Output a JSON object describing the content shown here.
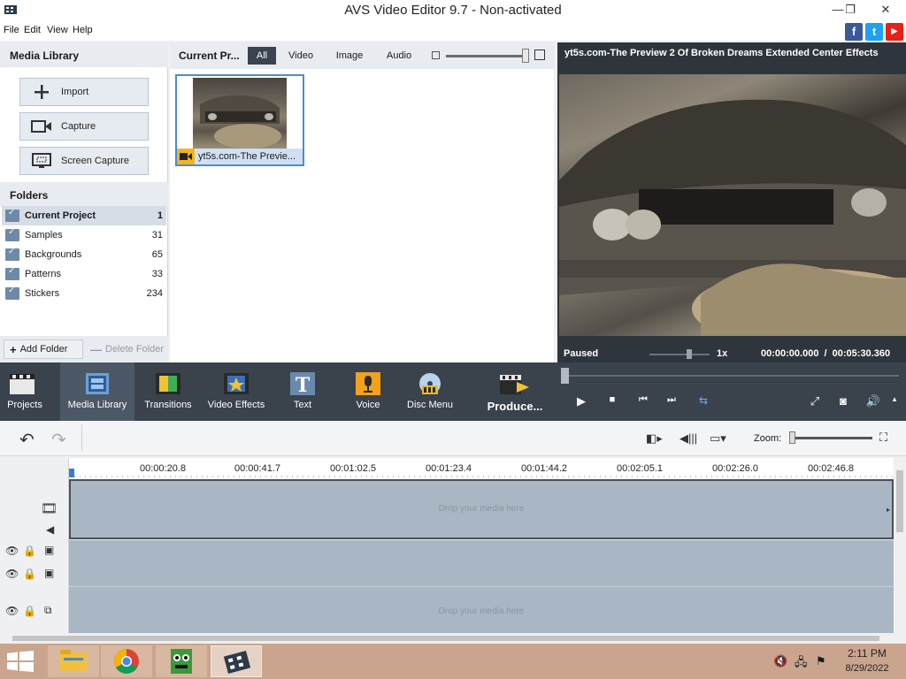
{
  "window": {
    "title": "AVS Video Editor 9.7 - Non-activated",
    "minimize_icon": "—",
    "restore_icon": "❐",
    "close_icon": "✕"
  },
  "menu": [
    "File",
    "Edit",
    "View",
    "Help"
  ],
  "social": {
    "facebook": "f",
    "twitter": "t",
    "youtube": "▶"
  },
  "media_library": {
    "title": "Media Library",
    "buttons": [
      "Import",
      "Capture",
      "Screen Capture"
    ]
  },
  "folders": {
    "title": "Folders",
    "items": [
      {
        "name": "Current Project",
        "count": "1"
      },
      {
        "name": "Samples",
        "count": "31"
      },
      {
        "name": "Backgrounds",
        "count": "65"
      },
      {
        "name": "Patterns",
        "count": "33"
      },
      {
        "name": "Stickers",
        "count": "234"
      }
    ],
    "add_label": "Add Folder",
    "delete_label": "Delete Folder"
  },
  "center": {
    "title": "Current Pr...",
    "tabs": [
      "All",
      "Video",
      "Image",
      "Audio"
    ],
    "active_tab": "All",
    "items": [
      {
        "caption": "yt5s.com-The Previe..."
      }
    ]
  },
  "preview": {
    "title": "yt5s.com-The Preview 2 Of Broken Dreams Extended Center Effects",
    "status": "Paused",
    "speed": "1x",
    "current_time": "00:00:00.000",
    "separator": "/",
    "total_time": "00:05:30.360"
  },
  "toolbar": {
    "items": [
      {
        "label": "Projects"
      },
      {
        "label": "Media Library"
      },
      {
        "label": "Transitions"
      },
      {
        "label": "Video Effects"
      },
      {
        "label": "Text"
      },
      {
        "label": "Voice"
      },
      {
        "label": "Disc Menu"
      },
      {
        "label": "Produce..."
      }
    ],
    "active": "Media Library"
  },
  "timeline": {
    "zoom_label": "Zoom:",
    "ticks": [
      "00:00:20.8",
      "00:00:41.7",
      "00:01:02.5",
      "00:01:23.4",
      "00:01:44.2",
      "00:02:05.1",
      "00:02:26.0",
      "00:02:46.8"
    ],
    "drop_text": "Drop your media here"
  },
  "taskbar": {
    "time": "2:11 PM",
    "date": "8/29/2022"
  },
  "colors": {
    "toolbar_bg": "#3a424c",
    "track_bg": "#a9b6c3",
    "accent": "#4a8ccf",
    "taskbar_bg": "#c9a58e"
  }
}
